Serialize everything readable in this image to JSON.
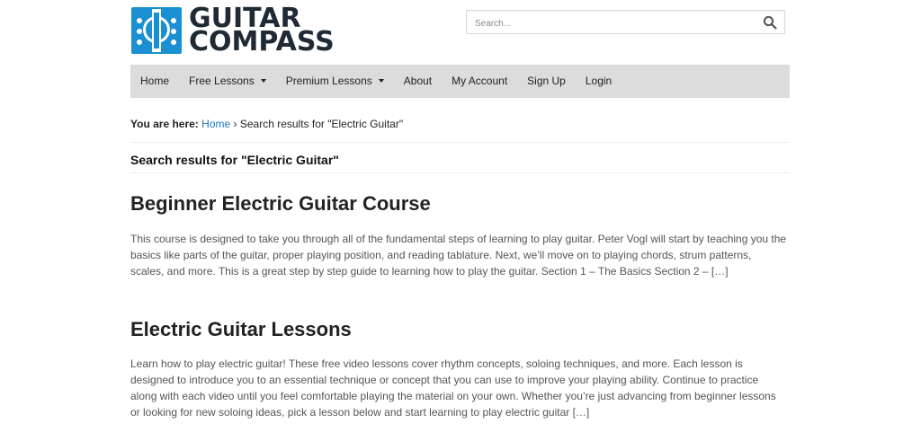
{
  "site": {
    "logo_line1": "GUITAR",
    "logo_line2": "COMPASS",
    "logo_icon": "guitar-headstock-icon",
    "brand_color": "#1a8fd1"
  },
  "search": {
    "placeholder": "Search...",
    "icon": "search-icon"
  },
  "nav": {
    "items": [
      {
        "label": "Home"
      },
      {
        "label": "Free Lessons",
        "dropdown": true
      },
      {
        "label": "Premium Lessons",
        "dropdown": true
      },
      {
        "label": "About"
      },
      {
        "label": "My Account"
      },
      {
        "label": "Sign Up"
      },
      {
        "label": "Login"
      }
    ]
  },
  "breadcrumb": {
    "prefix": "You are here:",
    "home": "Home",
    "separator": "›",
    "current": "Search results for \"Electric Guitar\""
  },
  "results_title": "Search results for \"Electric Guitar\"",
  "posts": [
    {
      "title": "Beginner Electric Guitar Course",
      "excerpt": "This course is designed to take you through all of the fundamental steps of learning to play guitar. Peter Vogl will start by teaching you the basics like parts of the guitar, proper playing position, and reading tablature. Next, we’ll move on to playing chords, strum patterns, scales, and more. This is a great step by step guide to learning how to play the guitar. Section 1 – The Basics      Section 2 – […]"
    },
    {
      "title": "Electric Guitar Lessons",
      "excerpt": "Learn how to play electric guitar! These free video lessons cover rhythm concepts, soloing techniques, and more. Each lesson is designed to introduce you to an essential technique or concept that you can use to improve your playing ability. Continue to practice along with each video until you feel comfortable playing the material on your own. Whether you’re just advancing from beginner lessons or looking for new soloing ideas, pick a lesson below and start learning to play electric guitar […]"
    }
  ]
}
